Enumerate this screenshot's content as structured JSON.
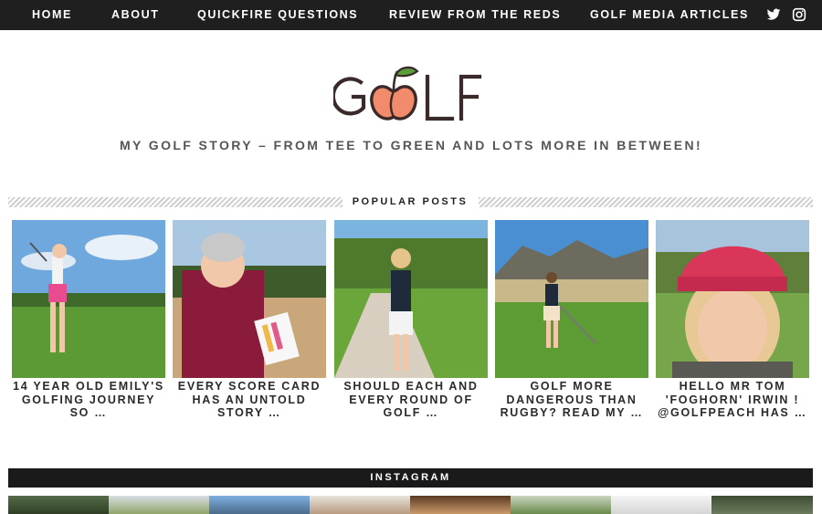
{
  "nav": {
    "items": [
      {
        "label": "HOME"
      },
      {
        "label": "ABOUT"
      },
      {
        "label": "QUICKFIRE QUESTIONS"
      },
      {
        "label": "REVIEW FROM THE REDS"
      },
      {
        "label": "GOLF MEDIA ARTICLES"
      }
    ],
    "social": [
      "twitter-icon",
      "instagram-icon"
    ]
  },
  "header": {
    "logo_text": "GOLF",
    "tagline": "MY GOLF STORY – FROM TEE TO GREEN AND LOTS MORE IN BETWEEN!"
  },
  "popular": {
    "heading": "POPULAR POSTS",
    "posts": [
      {
        "title": "14 YEAR OLD EMILY'S GOLFING JOURNEY SO …"
      },
      {
        "title": "EVERY SCORE CARD HAS AN UNTOLD STORY …"
      },
      {
        "title": "SHOULD EACH AND EVERY ROUND OF GOLF …"
      },
      {
        "title": "GOLF MORE DANGEROUS THAN RUGBY? READ MY …"
      },
      {
        "title": "HELLO MR TOM 'FOGHORN' IRWIN ! @GOLFPEACH HAS …"
      }
    ]
  },
  "instagram": {
    "heading": "INSTAGRAM"
  },
  "colors": {
    "nav_bg": "#1f1f1f",
    "peach": "#f28b6b",
    "leaf": "#5a9e3a",
    "logo_dark": "#3b2a2a"
  }
}
